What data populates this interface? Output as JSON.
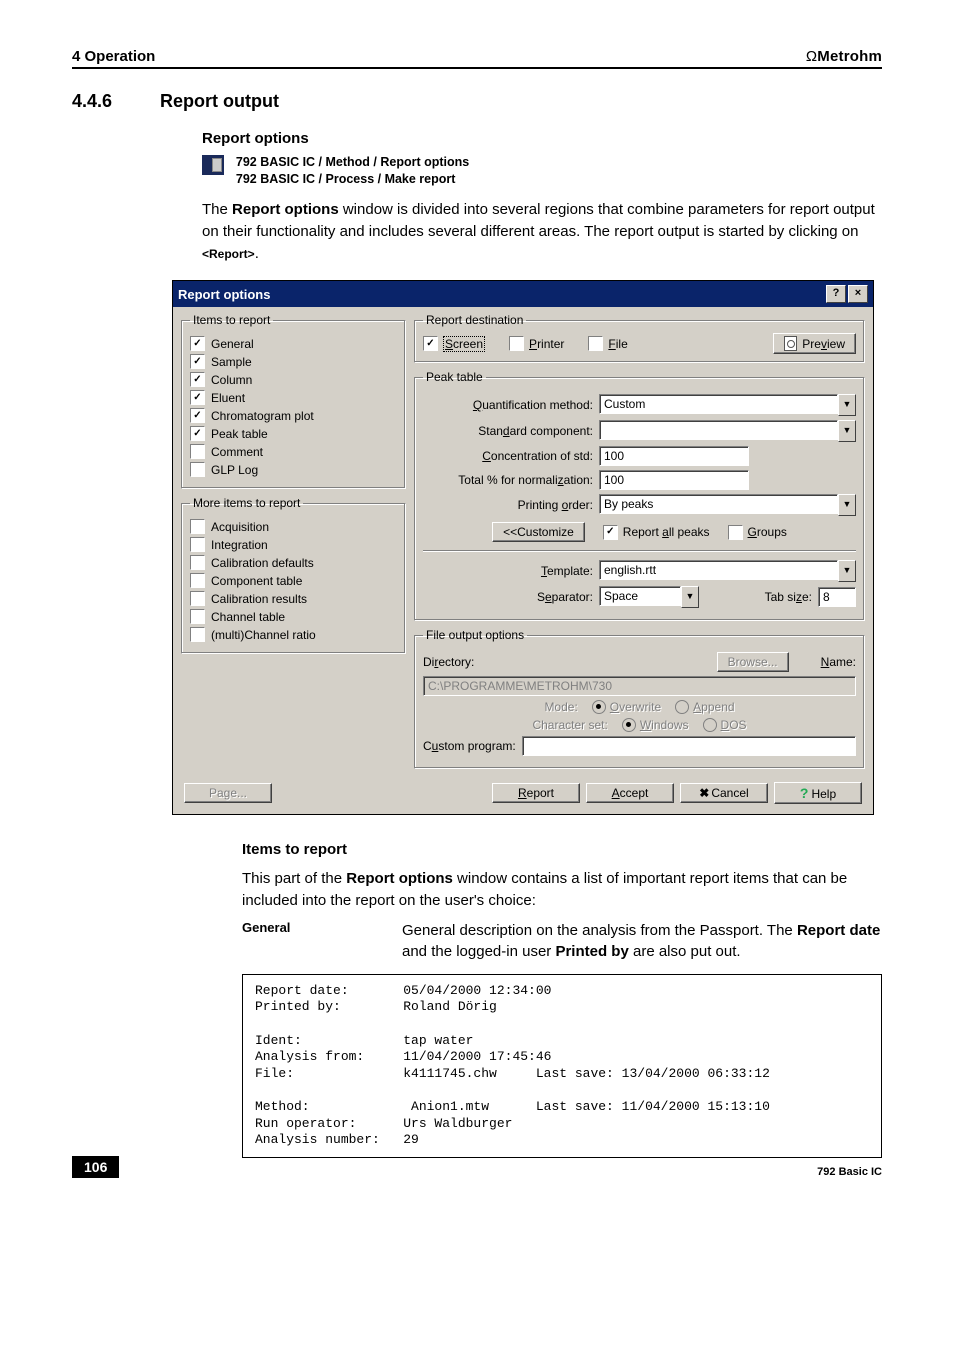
{
  "header": {
    "chapter": "4 Operation",
    "brand_prefix": "Ω",
    "brand": "Metrohm"
  },
  "section": {
    "number": "4.4.6",
    "title": "Report output"
  },
  "sub": {
    "report_options_head": "Report options"
  },
  "paths": {
    "p1": "792 BASIC IC / Method / Report options",
    "p2": "792 BASIC IC / Process / Make report"
  },
  "intro": {
    "pre": "The ",
    "bold1": "Report options",
    "mid": " window is divided into several regions that combine parameters for report output on their functionality and includes several different areas. The report output is started by clicking on ",
    "bold2": "<Report>",
    "post": "."
  },
  "dialog": {
    "title": "Report options",
    "items_legend": "Items to report",
    "items": [
      "General",
      "Sample",
      "Column",
      "Eluent",
      "Chromatogram plot",
      "Peak table",
      "Comment",
      "GLP Log"
    ],
    "items_checked": [
      true,
      true,
      true,
      true,
      true,
      true,
      false,
      false
    ],
    "more_legend": "More items to report",
    "more_items": [
      "Acquisition",
      "Integration",
      "Calibration defaults",
      "Component table",
      "Calibration results",
      "Channel table",
      "(multi)Channel ratio"
    ],
    "dest_legend": "Report destination",
    "dest": {
      "screen": "Screen",
      "printer": "Printer",
      "file": "File",
      "preview": "Preview"
    },
    "peak_legend": "Peak table",
    "peak": {
      "quant_label": "Quantification method:",
      "quant_value": "Custom",
      "std_label": "Standard component:",
      "std_value": "",
      "conc_label": "Concentration of std:",
      "conc_value": "100",
      "norm_label": "Total % for normalization:",
      "norm_value": "100",
      "order_label": "Printing order:",
      "order_value": "By peaks",
      "customize_btn": "<<Customize",
      "report_all": "Report all peaks",
      "groups": "Groups",
      "template_label": "Template:",
      "template_value": "english.rtt",
      "sep_label": "Separator:",
      "sep_value": "Space",
      "tabsize_label": "Tab size:",
      "tabsize_value": "8"
    },
    "fileopts": {
      "legend": "File output options",
      "dir_label": "Directory:",
      "browse": "Browse...",
      "name_label": "Name:",
      "dir_value": "C:\\PROGRAMME\\METROHM\\730",
      "mode_label": "Mode:",
      "overwrite": "Overwrite",
      "append": "Append",
      "charset_label": "Character set:",
      "windows": "Windows",
      "dos": "DOS",
      "custom_prog_label": "Custom program:",
      "custom_prog_value": ""
    },
    "footer": {
      "page": "Page...",
      "report": "Report",
      "accept": "Accept",
      "cancel": "Cancel",
      "help": "Help"
    }
  },
  "items_section": {
    "head": "Items to report",
    "lead_pre": "This part of the ",
    "lead_bold": "Report options",
    "lead_post": " window contains a list of important report items that can be included into the report on the user's choice:",
    "general_key": "General",
    "general_val_pre": "General description on the analysis from the Passport. The ",
    "general_val_b1": "Report date",
    "general_val_mid": " and the logged-in user ",
    "general_val_b2": "Printed by",
    "general_val_post": " are also put out."
  },
  "mono": "Report date:       05/04/2000 12:34:00\nPrinted by:        Roland Dörig\n\nIdent:             tap water\nAnalysis from:     11/04/2000 17:45:46\nFile:              k4111745.chw     Last save: 13/04/2000 06:33:12\n\nMethod:             Anion1.mtw      Last save: 11/04/2000 15:13:10\nRun operator:      Urs Waldburger\nAnalysis number:   29",
  "footer": {
    "pagenum": "106",
    "product": "792 Basic IC"
  }
}
